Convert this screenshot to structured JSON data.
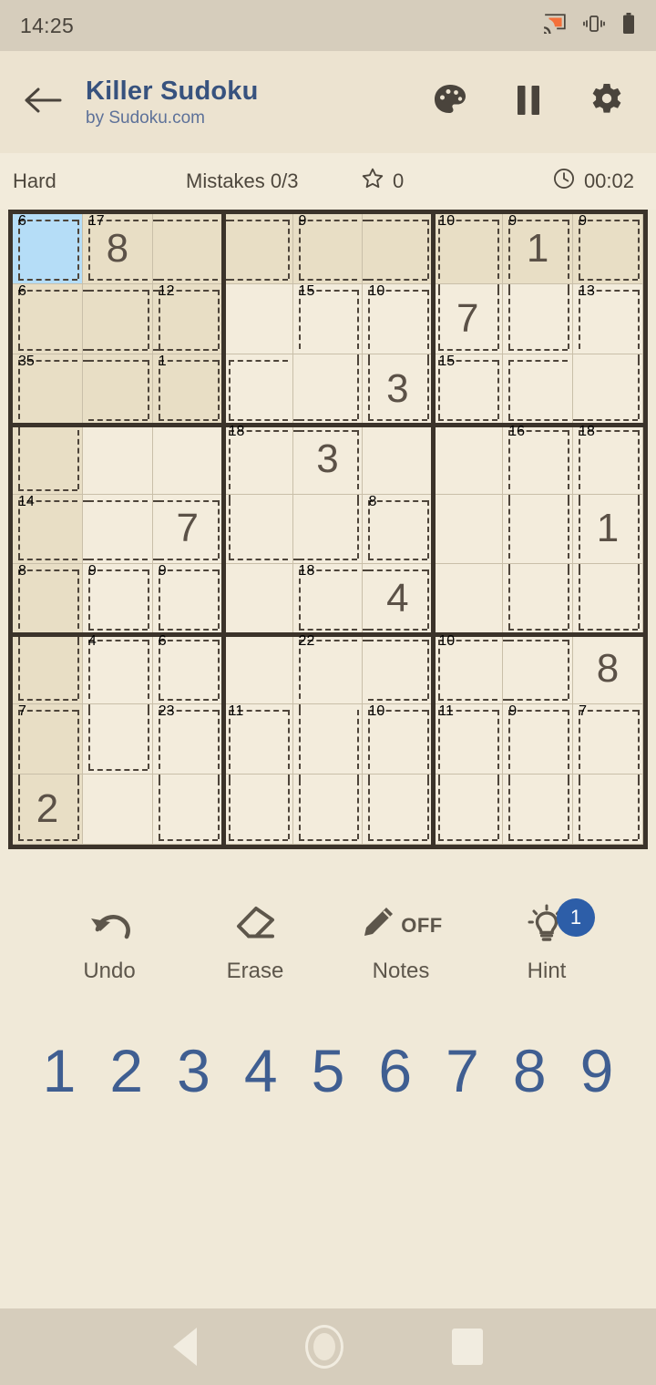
{
  "statusbar": {
    "time": "14:25",
    "icons": [
      "cast-icon",
      "vibrate-icon",
      "battery-icon"
    ]
  },
  "appbar": {
    "back_icon": "arrow-left-icon",
    "title": "Killer Sudoku",
    "subtitle": "by Sudoku.com",
    "actions": [
      {
        "name": "palette-icon",
        "label": "Theme"
      },
      {
        "name": "pause-icon",
        "label": "Pause"
      },
      {
        "name": "gear-icon",
        "label": "Settings"
      }
    ],
    "colors": {
      "title": "#37527e",
      "subtitle": "#5d7199"
    }
  },
  "infostrip": {
    "difficulty": "Hard",
    "mistakes": "Mistakes 0/3",
    "score": "0",
    "star_icon": "star-outline-icon",
    "clock_icon": "clock-icon",
    "time": "00:02"
  },
  "board": {
    "size": 9,
    "selected": {
      "row": 0,
      "col": 0
    },
    "colors": {
      "cell": "#f3ecdc",
      "highlight": "#e8dec5",
      "selected": "#b5ddf7",
      "thick_line": "#3b332a",
      "thin_line": "#c9bfa9",
      "value": "#5b5147",
      "cage_sum": "#2e2920"
    },
    "values": [
      [
        null,
        "8",
        null,
        null,
        null,
        null,
        null,
        "1",
        null
      ],
      [
        null,
        null,
        null,
        null,
        null,
        null,
        "7",
        null,
        null
      ],
      [
        null,
        null,
        null,
        null,
        null,
        "3",
        null,
        null,
        null
      ],
      [
        null,
        null,
        null,
        null,
        "3",
        null,
        null,
        null,
        null
      ],
      [
        null,
        null,
        "7",
        null,
        null,
        null,
        null,
        null,
        "1"
      ],
      [
        null,
        null,
        null,
        null,
        null,
        "4",
        null,
        null,
        null
      ],
      [
        null,
        null,
        null,
        null,
        null,
        null,
        null,
        null,
        "8"
      ],
      [
        null,
        null,
        null,
        null,
        null,
        null,
        null,
        null,
        null
      ],
      [
        "2",
        null,
        null,
        null,
        null,
        null,
        null,
        null,
        null
      ]
    ],
    "cages": [
      {
        "sum": "6",
        "cells": [
          [
            0,
            0
          ]
        ]
      },
      {
        "sum": "17",
        "cells": [
          [
            0,
            1
          ],
          [
            0,
            2
          ],
          [
            0,
            3
          ]
        ]
      },
      {
        "sum": "9",
        "cells": [
          [
            0,
            4
          ],
          [
            0,
            5
          ]
        ]
      },
      {
        "sum": "10",
        "cells": [
          [
            0,
            6
          ],
          [
            1,
            6
          ]
        ]
      },
      {
        "sum": "9",
        "cells": [
          [
            0,
            7
          ],
          [
            1,
            7
          ]
        ]
      },
      {
        "sum": "9",
        "cells": [
          [
            0,
            8
          ]
        ]
      },
      {
        "sum": "6",
        "cells": [
          [
            1,
            0
          ],
          [
            1,
            1
          ],
          [
            1,
            2
          ]
        ]
      },
      {
        "sum": "12",
        "cells": [
          [
            1,
            2
          ]
        ]
      },
      {
        "sum": "15",
        "cells": [
          [
            1,
            4
          ],
          [
            2,
            4
          ],
          [
            2,
            3
          ]
        ]
      },
      {
        "sum": "10",
        "cells": [
          [
            1,
            5
          ],
          [
            2,
            5
          ]
        ]
      },
      {
        "sum": "13",
        "cells": [
          [
            1,
            8
          ],
          [
            2,
            8
          ],
          [
            2,
            7
          ]
        ]
      },
      {
        "sum": "35",
        "cells": [
          [
            2,
            0
          ],
          [
            2,
            1
          ],
          [
            3,
            0
          ]
        ]
      },
      {
        "sum": "1",
        "cells": [
          [
            2,
            2
          ]
        ]
      },
      {
        "sum": "15",
        "cells": [
          [
            2,
            6
          ]
        ]
      },
      {
        "sum": "18",
        "cells": [
          [
            3,
            3
          ],
          [
            3,
            4
          ],
          [
            4,
            3
          ],
          [
            4,
            4
          ]
        ]
      },
      {
        "sum": "16",
        "cells": [
          [
            3,
            7
          ],
          [
            4,
            7
          ],
          [
            5,
            7
          ]
        ]
      },
      {
        "sum": "18",
        "cells": [
          [
            3,
            8
          ],
          [
            4,
            8
          ],
          [
            5,
            8
          ]
        ]
      },
      {
        "sum": "8",
        "cells": [
          [
            4,
            5
          ]
        ]
      },
      {
        "sum": "14",
        "cells": [
          [
            4,
            0
          ],
          [
            4,
            1
          ],
          [
            4,
            2
          ]
        ]
      },
      {
        "sum": "8",
        "cells": [
          [
            5,
            0
          ],
          [
            6,
            0
          ]
        ]
      },
      {
        "sum": "9",
        "cells": [
          [
            5,
            1
          ]
        ]
      },
      {
        "sum": "9",
        "cells": [
          [
            5,
            2
          ]
        ]
      },
      {
        "sum": "18",
        "cells": [
          [
            5,
            4
          ],
          [
            5,
            5
          ]
        ]
      },
      {
        "sum": "4",
        "cells": [
          [
            6,
            1
          ],
          [
            7,
            1
          ]
        ]
      },
      {
        "sum": "6",
        "cells": [
          [
            6,
            2
          ]
        ]
      },
      {
        "sum": "22",
        "cells": [
          [
            6,
            4
          ],
          [
            6,
            5
          ],
          [
            7,
            4
          ],
          [
            8,
            4
          ]
        ]
      },
      {
        "sum": "10",
        "cells": [
          [
            6,
            6
          ],
          [
            6,
            7
          ]
        ]
      },
      {
        "sum": "7",
        "cells": [
          [
            7,
            0
          ],
          [
            8,
            0
          ]
        ]
      },
      {
        "sum": "23",
        "cells": [
          [
            7,
            2
          ],
          [
            8,
            2
          ]
        ]
      },
      {
        "sum": "11",
        "cells": [
          [
            7,
            3
          ],
          [
            8,
            3
          ]
        ]
      },
      {
        "sum": "10",
        "cells": [
          [
            7,
            5
          ],
          [
            8,
            5
          ]
        ]
      },
      {
        "sum": "11",
        "cells": [
          [
            7,
            6
          ],
          [
            8,
            6
          ]
        ]
      },
      {
        "sum": "9",
        "cells": [
          [
            7,
            7
          ],
          [
            8,
            7
          ]
        ]
      },
      {
        "sum": "7",
        "cells": [
          [
            7,
            8
          ],
          [
            8,
            8
          ]
        ]
      }
    ]
  },
  "actions": [
    {
      "name": "undo-button",
      "icon": "undo-icon",
      "label": "Undo"
    },
    {
      "name": "erase-button",
      "icon": "eraser-icon",
      "label": "Erase"
    },
    {
      "name": "notes-button",
      "icon": "pencil-icon",
      "label": "Notes",
      "state": "OFF"
    },
    {
      "name": "hint-button",
      "icon": "lightbulb-icon",
      "label": "Hint",
      "badge": "1"
    }
  ],
  "numpad": [
    "1",
    "2",
    "3",
    "4",
    "5",
    "6",
    "7",
    "8",
    "9"
  ],
  "navbar": {
    "back": "nav-back-icon",
    "home": "nav-home-icon",
    "recent": "nav-recent-icon"
  }
}
